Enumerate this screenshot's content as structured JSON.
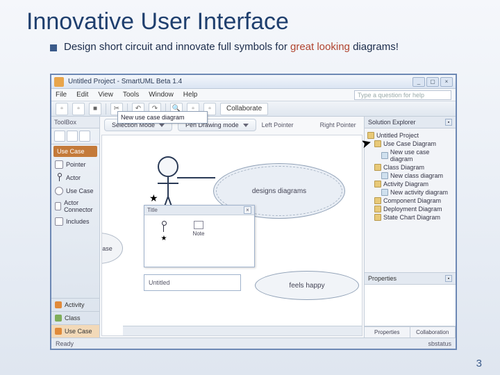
{
  "slide": {
    "title": "Innovative User Interface",
    "bullet_a": "Design short circuit and innovate full symbols for",
    "bullet_b": "great looking",
    "bullet_c": "diagrams!",
    "number": "3"
  },
  "app": {
    "title": "Untitled Project - SmartUML Beta 1.4",
    "menu": {
      "file": "File",
      "edit": "Edit",
      "view": "View",
      "tools": "Tools",
      "window": "Window",
      "help": "Help"
    },
    "help_placeholder": "Type a question for help",
    "toolbar": {
      "collaborate": "Collaborate"
    }
  },
  "left": {
    "header": "ToolBox",
    "category": "Use Case",
    "items": {
      "pointer": "Pointer",
      "actor": "Actor",
      "usecase": "Use Case",
      "actor_connector": "Actor Connector",
      "includes": "Includes"
    },
    "tabs": {
      "activity": "Activity",
      "class_": "Class",
      "usecase": "Use Case"
    }
  },
  "sub": {
    "selection": "Selection Mode",
    "pen": "Pen Drawing mode",
    "left_ptr": "Left  Pointer",
    "right_ptr": "Right  Pointer"
  },
  "popup": {
    "new_uc": "New use case diagram"
  },
  "canvas": {
    "designs": "designs diagrams",
    "untitled": "Untitled",
    "feels": "feels happy",
    "inner_title": "Title",
    "note": "Note",
    "balloon": "Use Case"
  },
  "right": {
    "header": "Solution Explorer",
    "tree": {
      "root": "Untitled Project",
      "n1": "Use Case Diagram",
      "n2": "New use case diagram",
      "n3": "Class Diagram",
      "n4": "New class diagram",
      "n5": "Activity Diagram",
      "n6": "New activity diagram",
      "n7": "Component Diagram",
      "n8": "Deployment Diagram",
      "n9": "State Chart Diagram"
    },
    "properties": "Properties",
    "tab_props": "Properties",
    "tab_collab": "Collaboration"
  },
  "status": {
    "left": "Ready",
    "right": "sbstatus"
  }
}
